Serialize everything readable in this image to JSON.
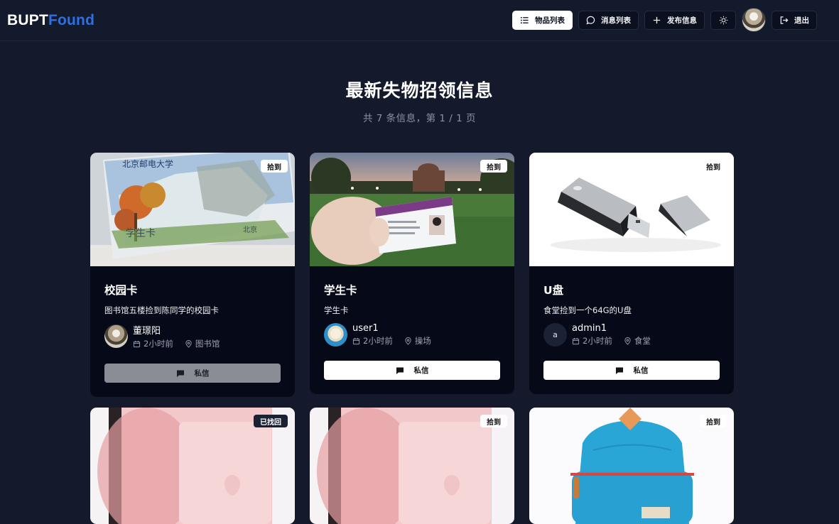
{
  "brand": {
    "part1": "BUPT",
    "part2": "Found"
  },
  "nav": {
    "items_label": "物品列表",
    "messages_label": "消息列表",
    "publish_label": "发布信息",
    "logout_label": "退出"
  },
  "heading": {
    "title": "最新失物招领信息",
    "subtitle": "共 7 条信息，第 1 / 1 页"
  },
  "cards": [
    {
      "badge": "拾到",
      "title": "校园卡",
      "desc": "图书馆五楼捡到陈同学的校园卡",
      "owner": "董璟阳",
      "time": "2小时前",
      "location": "图书馆",
      "button": "私信",
      "image_icon": "campus-card-photo"
    },
    {
      "badge": "拾到",
      "title": "学生卡",
      "desc": "学生卡",
      "owner": "user1",
      "time": "2小时前",
      "location": "操场",
      "button": "私信",
      "image_icon": "student-card-photo"
    },
    {
      "badge": "拾到",
      "title": "U盘",
      "desc": "食堂捡到一个64G的U盘",
      "owner": "admin1",
      "owner_initial": "a",
      "time": "2小时前",
      "location": "食堂",
      "button": "私信",
      "image_icon": "usb-drive-photo"
    },
    {
      "badge": "已找回",
      "image_icon": "phone-photo"
    },
    {
      "badge": "拾到",
      "image_icon": "phone-photo"
    },
    {
      "badge": "拾到",
      "image_icon": "backpack-photo"
    }
  ],
  "colors": {
    "background": "#141a2c",
    "card": "#060a18",
    "accent": "#2f6fe0"
  }
}
